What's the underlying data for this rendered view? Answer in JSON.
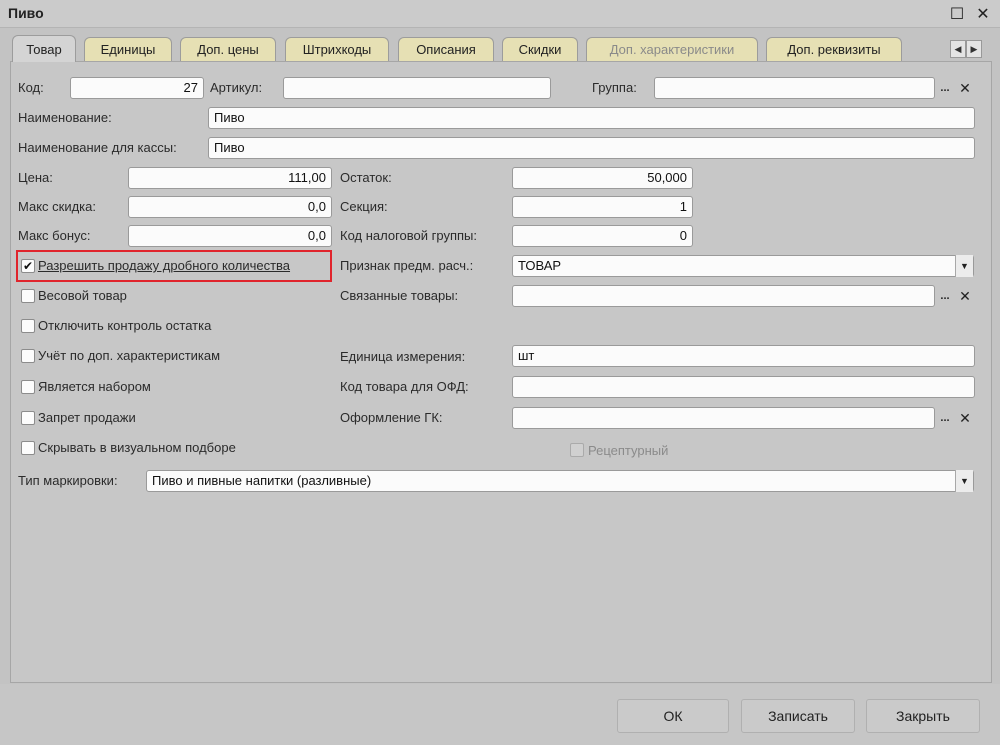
{
  "window": {
    "title": "Пиво"
  },
  "tabs": [
    {
      "label": "Товар"
    },
    {
      "label": "Единицы"
    },
    {
      "label": "Доп. цены"
    },
    {
      "label": "Штрихкоды"
    },
    {
      "label": "Описания"
    },
    {
      "label": "Скидки"
    },
    {
      "label": "Доп. характеристики"
    },
    {
      "label": "Доп. реквизиты"
    }
  ],
  "fields": {
    "code": {
      "label": "Код:",
      "value": "27"
    },
    "article": {
      "label": "Артикул:",
      "value": ""
    },
    "group": {
      "label": "Группа:",
      "value": ""
    },
    "name": {
      "label": "Наименование:",
      "value": "Пиво"
    },
    "cash_name": {
      "label": "Наименование для кассы:",
      "value": "Пиво"
    },
    "price": {
      "label": "Цена:",
      "value": "111,00"
    },
    "max_discount": {
      "label": "Макс скидка:",
      "value": "0,0"
    },
    "max_bonus": {
      "label": "Макс бонус:",
      "value": "0,0"
    },
    "stock": {
      "label": "Остаток:",
      "value": "50,000"
    },
    "section": {
      "label": "Секция:",
      "value": "1"
    },
    "tax_group": {
      "label": "Код налоговой группы:",
      "value": "0"
    },
    "payment_subject": {
      "label": "Признак предм. расч.:",
      "value": "ТОВАР"
    },
    "related": {
      "label": "Связанные товары:",
      "value": ""
    },
    "unit": {
      "label": "Единица измерения:",
      "value": "шт"
    },
    "ofd_code": {
      "label": "Код товара для ОФД:",
      "value": ""
    },
    "gk": {
      "label": "Оформление ГК:",
      "value": ""
    },
    "marking": {
      "label": "Тип маркировки:",
      "value": "Пиво и пивные напитки (разливные)"
    }
  },
  "checkboxes": {
    "fractional": {
      "label": "Разрешить продажу дробного количества",
      "checked": true
    },
    "weight": {
      "label": "Весовой товар",
      "checked": false
    },
    "disable_stock": {
      "label": "Отключить контроль остатка",
      "checked": false
    },
    "characteristics": {
      "label": "Учёт по доп. характеристикам",
      "checked": false
    },
    "is_set": {
      "label": "Является набором",
      "checked": false
    },
    "sale_ban": {
      "label": "Запрет продажи",
      "checked": false
    },
    "hide_visual": {
      "label": "Скрывать в визуальном подборе",
      "checked": false
    },
    "prescription": {
      "label": "Рецептурный",
      "checked": false
    }
  },
  "icons": {
    "check": "✔",
    "dots": "...",
    "clear": "✕",
    "dropdown": "▼",
    "maximize": "☐",
    "close": "✕",
    "tab_left": "◀",
    "tab_right": "▶"
  },
  "buttons": {
    "ok": "ОК",
    "save": "Записать",
    "close": "Закрыть"
  },
  "colors": {
    "highlight": "#e0242c",
    "tab_inactive": "#e6e0b4",
    "background": "#c3c3c3"
  }
}
